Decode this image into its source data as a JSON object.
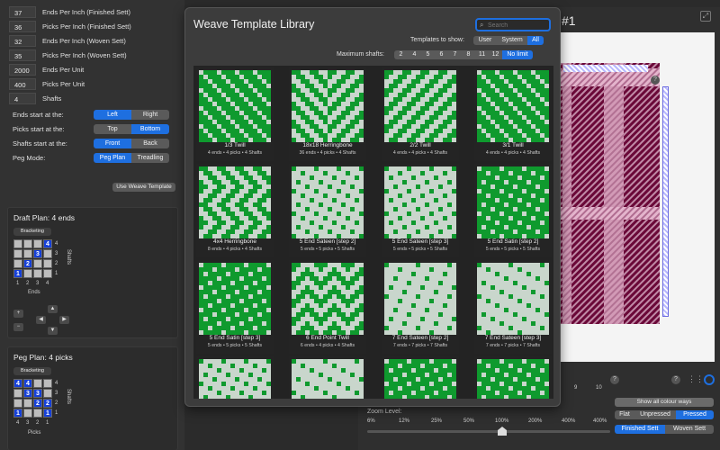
{
  "params": [
    {
      "value": "37",
      "label": "Ends Per Inch (Finished Sett)"
    },
    {
      "value": "36",
      "label": "Picks Per Inch (Finished Sett)"
    },
    {
      "value": "32",
      "label": "Ends Per Inch (Woven Sett)"
    },
    {
      "value": "35",
      "label": "Picks Per Inch (Woven Sett)"
    },
    {
      "value": "2000",
      "label": "Ends Per Unit"
    },
    {
      "value": "400",
      "label": "Picks Per Unit"
    },
    {
      "value": "4",
      "label": "Shafts"
    }
  ],
  "options": {
    "ends_label": "Ends start at the:",
    "ends_opts": [
      "Left",
      "Right"
    ],
    "picks_label": "Picks start at the:",
    "picks_opts": [
      "Top",
      "Bottom"
    ],
    "shafts_label": "Shafts start at the:",
    "shafts_opts": [
      "Front",
      "Back"
    ],
    "peg_label": "Peg Mode:",
    "peg_opts": [
      "Peg Plan",
      "Treadling"
    ]
  },
  "use_template_btn": "Use Weave Template",
  "draft": {
    "title": "Draft Plan:",
    "count": "4 ends",
    "bracketing": "Bracketing",
    "shafts_label": "Shafts",
    "ends_label": "Ends",
    "row_nums": [
      "4",
      "3",
      "2",
      "1"
    ],
    "col_nums": [
      "1",
      "2",
      "3",
      "4"
    ],
    "grid_nums": [
      "4",
      "3",
      "2",
      "1"
    ]
  },
  "peg": {
    "title": "Peg Plan:",
    "count": "4 picks",
    "bracketing": "Bracketing",
    "shafts_label": "Shafts",
    "picks_label": "Picks",
    "row_nums": [
      "4",
      "3",
      "2",
      "1"
    ],
    "col_nums": [
      "4",
      "3",
      "2",
      "1"
    ],
    "grid_nums": [
      "4",
      "4",
      "3",
      "3",
      "2",
      "2",
      "1",
      "1"
    ]
  },
  "library": {
    "title": "Weave Template Library",
    "search_placeholder": "Search",
    "show_label": "Templates to show:",
    "show_opts": [
      "User",
      "System",
      "All"
    ],
    "shafts_label": "Maximum shafts:",
    "shaft_opts": [
      "2",
      "4",
      "5",
      "6",
      "7",
      "8",
      "11",
      "12",
      "No limit"
    ],
    "templates": [
      {
        "name": "1/3 Twill",
        "info": "4 ends • 4 picks • 4 Shafts"
      },
      {
        "name": "18x18 Herringbone",
        "info": "36 ends • 4 picks • 4 Shafts"
      },
      {
        "name": "2/2 Twill",
        "info": "4 ends • 4 picks • 4 Shafts"
      },
      {
        "name": "3/1 Twill",
        "info": "4 ends • 4 picks • 4 Shafts"
      },
      {
        "name": "4x4 Herringbone",
        "info": "8 ends • 4 picks • 4 Shafts"
      },
      {
        "name": "5 End Sateen [step 2]",
        "info": "5 ends • 5 picks • 5 Shafts"
      },
      {
        "name": "5 End Sateen [step 3]",
        "info": "5 ends • 5 picks • 5 Shafts"
      },
      {
        "name": "5 End Satin [step 2]",
        "info": "5 ends • 5 picks • 5 Shafts"
      },
      {
        "name": "5 End Satin [step 3]",
        "info": "5 ends • 5 picks • 5 Shafts"
      },
      {
        "name": "6 End Point Twill",
        "info": "6 ends • 4 picks • 4 Shafts"
      },
      {
        "name": "7 End Sateen [step 2]",
        "info": "7 ends • 7 picks • 7 Shafts"
      },
      {
        "name": "7 End Sateen [step 3]",
        "info": "7 ends • 7 picks • 7 Shafts"
      }
    ]
  },
  "right": {
    "title_suffix": "#1",
    "num_a": "9",
    "num_b": "10",
    "show_colour_ways": "Show all colour ways",
    "press_opts": [
      "Flat",
      "Unpressed",
      "Pressed"
    ],
    "sett_opts": [
      "Finished Sett",
      "Woven Sett"
    ],
    "zoom_label": "Zoom Level:",
    "zoom_ticks": [
      "6%",
      "12%",
      "25%",
      "50%",
      "100%",
      "200%",
      "400%",
      "400%"
    ],
    "zoom_value": "100%"
  },
  "colors": {
    "accent": "#1e6fe0",
    "weave_green": "#0f9a2e",
    "weave_light": "#c9d6cc",
    "plaid_purple": "#7a0a4a",
    "plaid_pink": "#d8a0bc"
  }
}
